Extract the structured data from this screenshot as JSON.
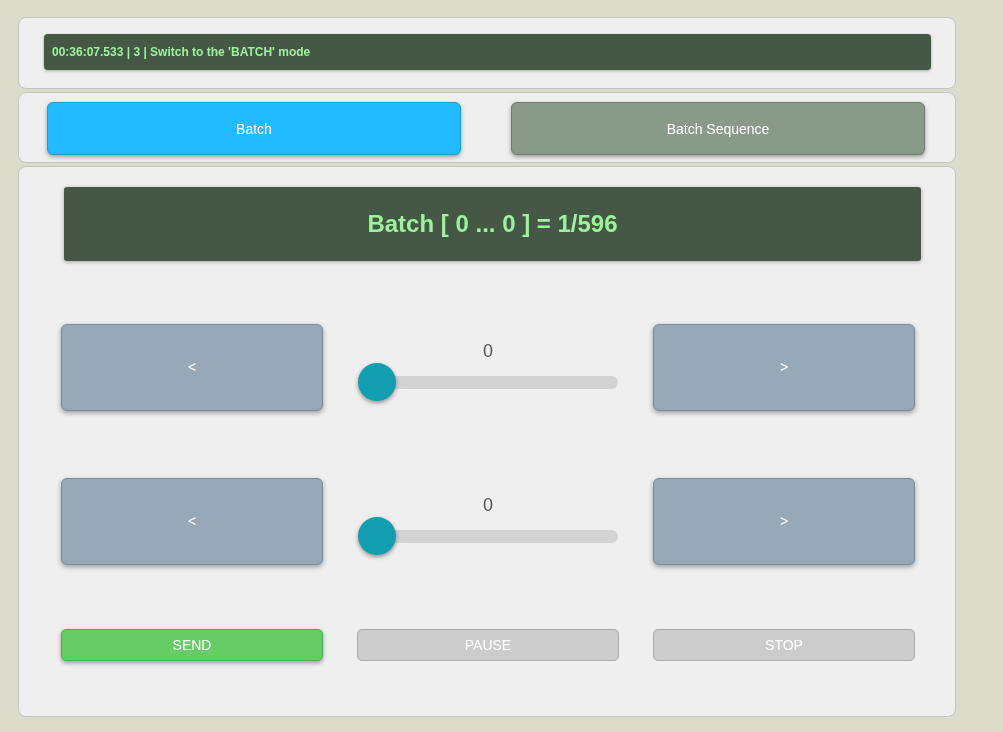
{
  "log": {
    "text": "00:36:07.533 | 3 | Switch to the 'BATCH' mode"
  },
  "tabs": [
    {
      "label": "Batch",
      "selected": true
    },
    {
      "label": "Batch Sequence",
      "selected": false
    }
  ],
  "header": {
    "title": "Batch [ 0 ... 0 ] = 1/596"
  },
  "steppers": [
    {
      "prev": "<",
      "next": ">",
      "reading": "0",
      "level": 0
    },
    {
      "prev": "<",
      "next": ">",
      "reading": "0",
      "level": 0
    }
  ],
  "actions": [
    {
      "label": "SEND",
      "disabled": false
    },
    {
      "label": "PAUSE",
      "disabled": true
    },
    {
      "label": "STOP",
      "disabled": true
    }
  ]
}
